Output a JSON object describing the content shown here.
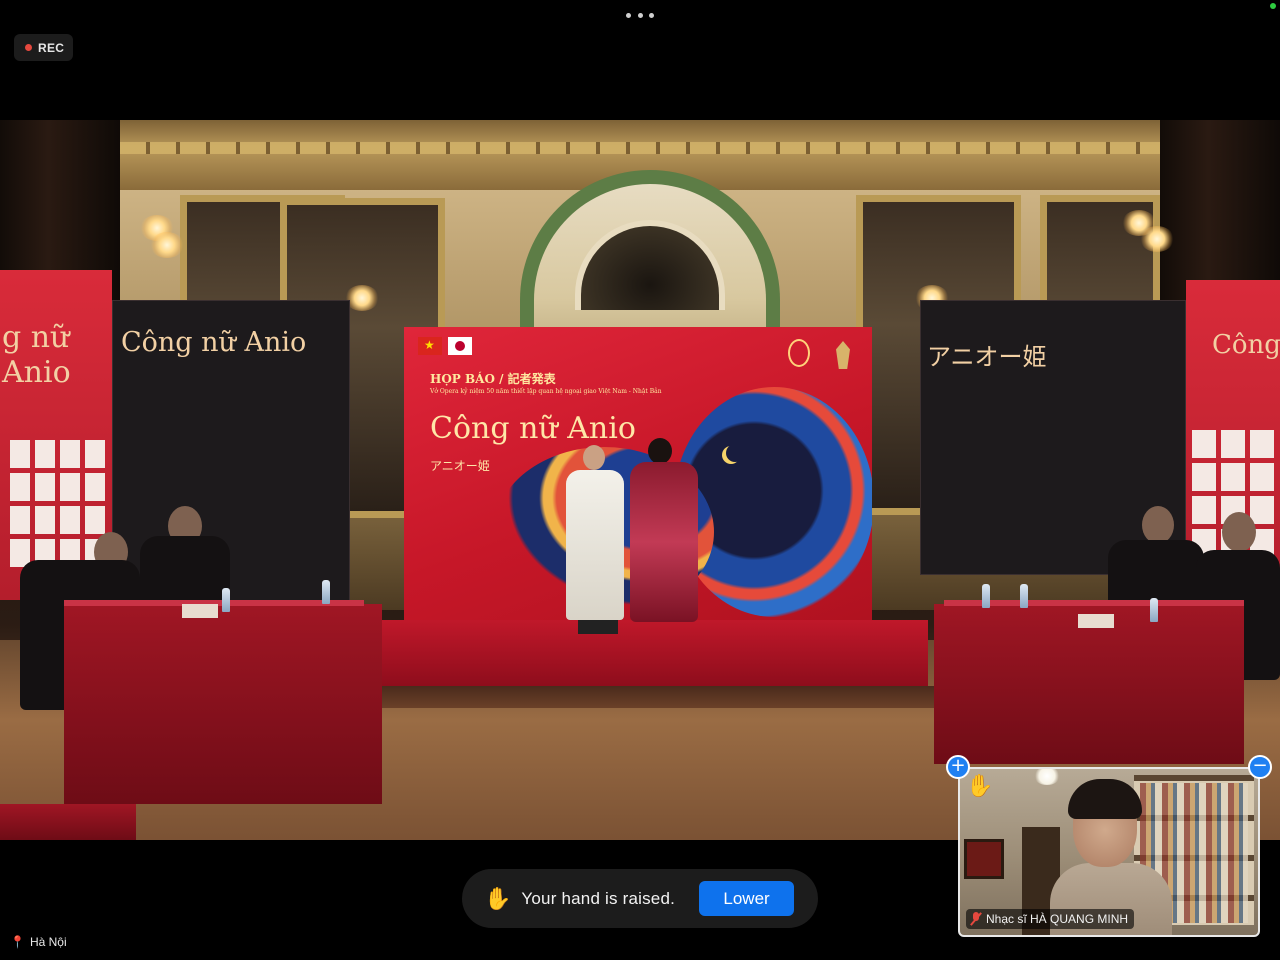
{
  "window": {
    "more_icon": "more-dots-icon"
  },
  "recording": {
    "label": "REC",
    "dot_color": "#e5483e"
  },
  "backdrop": {
    "title": "HỌP BÁO / 記者発表",
    "subtitle": "Vở Opera kỷ niệm 50 năm thiết lập quan hệ ngoại giao Việt Nam - Nhật Bản",
    "show_name": "Công nữ Anio",
    "show_name_jp": "アニオー姫"
  },
  "left_panel": {
    "title": "Công nữ Anio",
    "side_title": "g nữ Anio"
  },
  "right_panel": {
    "title": "アニオー姫",
    "side_title": "Công"
  },
  "hand_raise": {
    "icon": "✋",
    "message": "Your hand is raised.",
    "lower_label": "Lower",
    "button_color": "#0e72ed"
  },
  "self_view": {
    "hand_icon": "✋",
    "participant_name": "Nhạc sĩ HÀ QUANG MINH",
    "mic_state": "muted",
    "zoom_in_label": "+",
    "zoom_out_label": "−"
  },
  "location": {
    "icon": "pin-icon",
    "label": "Hà Nội"
  }
}
